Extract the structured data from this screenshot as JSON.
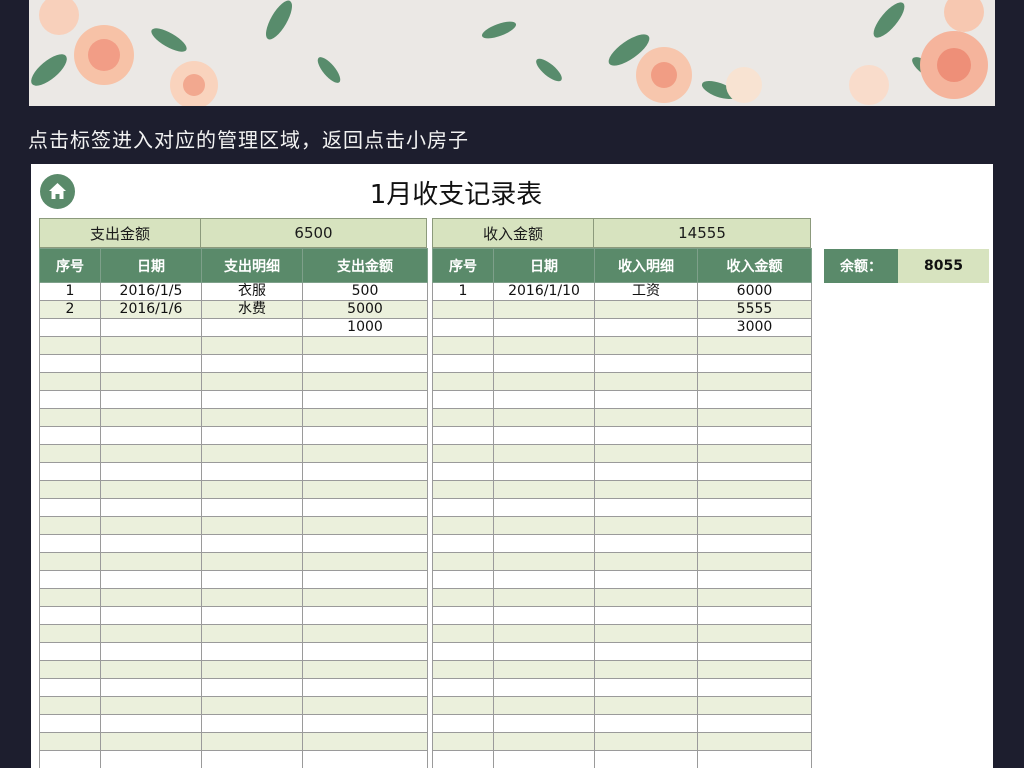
{
  "instruction_text": "点击标签进入对应的管理区域，返回点击小房子",
  "sheet": {
    "title": "1月收支记录表",
    "home_icon": "home-icon"
  },
  "expense": {
    "total_label": "支出金额",
    "total_value": "6500",
    "headers": [
      "序号",
      "日期",
      "支出明细",
      "支出金额"
    ],
    "rows": [
      [
        "1",
        "2016/1/5",
        "衣服",
        "500"
      ],
      [
        "2",
        "2016/1/6",
        "水费",
        "5000"
      ],
      [
        "",
        "",
        "",
        "1000"
      ]
    ]
  },
  "income": {
    "total_label": "收入金额",
    "total_value": "14555",
    "headers": [
      "序号",
      "日期",
      "收入明细",
      "收入金额"
    ],
    "rows": [
      [
        "1",
        "2016/1/10",
        "工资",
        "6000"
      ],
      [
        "",
        "",
        "",
        "5555"
      ],
      [
        "",
        "",
        "",
        "3000"
      ]
    ]
  },
  "balance": {
    "label": "余额：",
    "value": "8055"
  },
  "colors": {
    "background": "#1d1e2e",
    "header_green": "#5a8a6a",
    "summary_fill": "#d7e3bf",
    "row_alt": "#ebf0dc"
  }
}
